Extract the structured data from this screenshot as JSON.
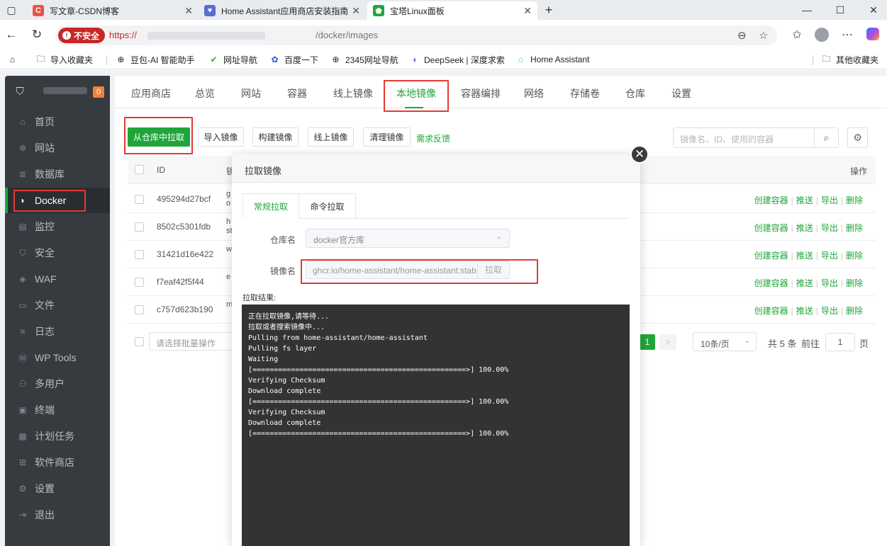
{
  "browser": {
    "tabs": [
      {
        "title": "写文章-CSDN博客",
        "favicon_color": "#e9524a",
        "favicon_text": "C"
      },
      {
        "title": "Home Assistant应用商店安装指南",
        "favicon_color": "#5b6bd4",
        "favicon_text": "♥"
      },
      {
        "title": "宝塔Linux面板",
        "favicon_color": "#20a53a",
        "favicon_text": "⬟"
      }
    ],
    "security_label": "不安全",
    "url_scheme": "https://",
    "url_tail": "/docker/images",
    "bookmarks": [
      "导入收藏夹",
      "豆包-AI 智能助手",
      "网址导航",
      "百度一下",
      "2345网址导航",
      "DeepSeek | 深度求索",
      "Home Assistant"
    ],
    "other_bookmarks": "其他收藏夹"
  },
  "sidebar": {
    "badge": "0",
    "items": [
      {
        "label": "首页",
        "icon": "home-icon"
      },
      {
        "label": "网站",
        "icon": "globe-icon"
      },
      {
        "label": "数据库",
        "icon": "database-icon"
      },
      {
        "label": "Docker",
        "icon": "docker-icon"
      },
      {
        "label": "监控",
        "icon": "monitor-icon"
      },
      {
        "label": "安全",
        "icon": "shield-icon"
      },
      {
        "label": "WAF",
        "icon": "waf-icon"
      },
      {
        "label": "文件",
        "icon": "folder-icon"
      },
      {
        "label": "日志",
        "icon": "log-icon"
      },
      {
        "label": "WP Tools",
        "icon": "wordpress-icon"
      },
      {
        "label": "多用户",
        "icon": "users-icon"
      },
      {
        "label": "终端",
        "icon": "terminal-icon"
      },
      {
        "label": "计划任务",
        "icon": "calendar-icon"
      },
      {
        "label": "软件商店",
        "icon": "apps-icon"
      },
      {
        "label": "设置",
        "icon": "gear-icon"
      },
      {
        "label": "退出",
        "icon": "logout-icon"
      }
    ],
    "active_index": 3
  },
  "topnav": {
    "tabs": [
      "应用商店",
      "总览",
      "网站",
      "容器",
      "线上镜像",
      "本地镜像",
      "容器编排",
      "网络",
      "存储卷",
      "仓库",
      "设置"
    ],
    "active_index": 5
  },
  "toolbar": {
    "pull_from_repo": "从仓库中拉取",
    "import_image": "导入镜像",
    "build_image": "构建镜像",
    "online_image": "线上镜像",
    "clean_image": "清理镜像",
    "feedback": "需求反馈",
    "search_placeholder": "镜像名、ID、使用的容器"
  },
  "table": {
    "col_id": "ID",
    "col_name": "镜",
    "col_actions": "操作",
    "rows": [
      {
        "id": "495294d27bcf",
        "name": "g o"
      },
      {
        "id": "8502c5301fdb",
        "name": "h st"
      },
      {
        "id": "31421d16e422",
        "name": "w"
      },
      {
        "id": "f7eaf42f5f44",
        "name": "e"
      },
      {
        "id": "c757d623b190",
        "name": "m"
      }
    ],
    "actions": [
      "创建容器",
      "推送",
      "导出",
      "删除"
    ]
  },
  "footer": {
    "batch_placeholder": "请选择批量操作",
    "current_page": "1",
    "next": ">",
    "page_size": "10条/页",
    "total": "共 5 条",
    "goto": "前往",
    "goto_value": "1",
    "page_suffix": "页"
  },
  "modal": {
    "title": "拉取镜像",
    "tabs": [
      "常规拉取",
      "命令拉取"
    ],
    "repo_label": "仓库名",
    "repo_value": "docker官方库",
    "image_label": "镜像名",
    "image_value": "ghcr.io/home-assistant/home-assistant:stab",
    "pull_button": "拉取",
    "result_label": "拉取结果:",
    "console_lines": [
      "正在拉取镜像,请等待...",
      "拉取或者搜索镜像中...",
      "Pulling from home-assistant/home-assistant",
      "Pulling fs layer",
      "Waiting",
      "[==================================================>] 100.00%",
      "Verifying Checksum",
      "Download complete",
      "[==================================================>] 100.00%",
      "Verifying Checksum",
      "Download complete",
      "[==================================================>] 100.00%"
    ]
  },
  "colors": {
    "accent": "#20a53a",
    "sidebar_bg": "#363b40",
    "highlight": "#e53935",
    "console_bg": "#333333"
  }
}
